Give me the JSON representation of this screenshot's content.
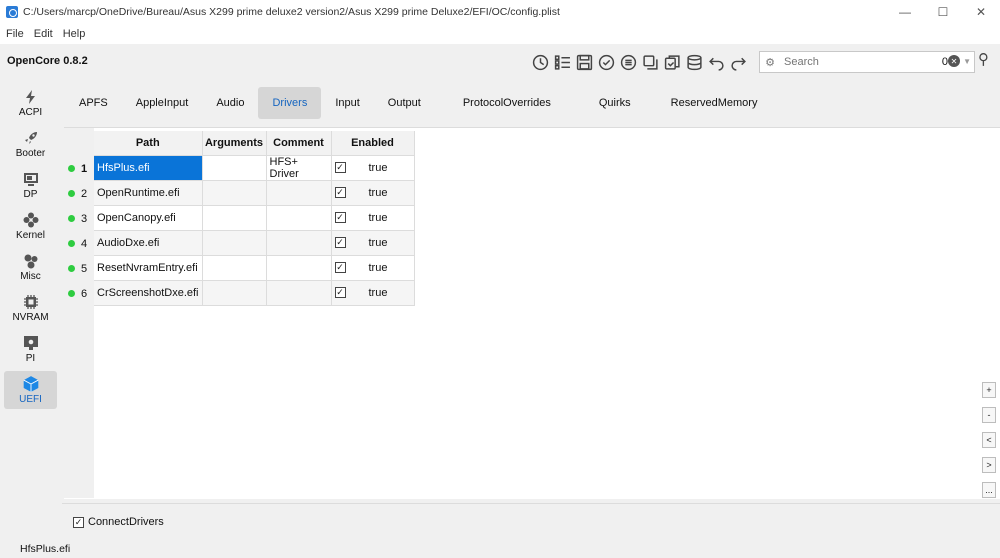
{
  "window": {
    "title": "C:/Users/marcp/OneDrive/Bureau/Asus X299 prime deluxe2 version2/Asus X299 prime Deluxe2/EFI/OC/config.plist",
    "controls": [
      "—",
      "☐",
      "✕"
    ]
  },
  "menu": [
    "File",
    "Edit",
    "Help"
  ],
  "toolbar": {
    "app_version": "OpenCore 0.8.2",
    "icons": [
      "clock-icon",
      "list-icon",
      "save-icon",
      "check-icon",
      "dots-icon",
      "layers-icon",
      "copy-icon",
      "database-icon",
      "undo-icon",
      "redo-icon"
    ],
    "search_placeholder": "Search",
    "search_count": "0"
  },
  "sidebar": [
    {
      "label": "ACPI",
      "icon": "bolt-icon"
    },
    {
      "label": "Booter",
      "icon": "rocket-icon"
    },
    {
      "label": "DP",
      "icon": "device-icon"
    },
    {
      "label": "Kernel",
      "icon": "kernel-icon"
    },
    {
      "label": "Misc",
      "icon": "misc-icon"
    },
    {
      "label": "NVRAM",
      "icon": "chip-icon"
    },
    {
      "label": "PI",
      "icon": "apple-icon"
    },
    {
      "label": "UEFI",
      "icon": "cube-icon",
      "active": true
    }
  ],
  "tabs": [
    {
      "label": "APFS"
    },
    {
      "label": "AppleInput"
    },
    {
      "label": "Audio"
    },
    {
      "label": "Drivers",
      "active": true
    },
    {
      "label": "Input"
    },
    {
      "label": "Output"
    },
    {
      "label": "ProtocolOverrides"
    },
    {
      "label": "Quirks"
    },
    {
      "label": "ReservedMemory"
    }
  ],
  "table": {
    "headers": [
      "Path",
      "Arguments",
      "Comment",
      "Enabled"
    ],
    "rows": [
      {
        "num": "1",
        "path": "HfsPlus.efi",
        "arguments": "",
        "comment": "HFS+ Driver",
        "enabled": "true",
        "selected": true
      },
      {
        "num": "2",
        "path": "OpenRuntime.efi",
        "arguments": "",
        "comment": "",
        "enabled": "true"
      },
      {
        "num": "3",
        "path": "OpenCanopy.efi",
        "arguments": "",
        "comment": "",
        "enabled": "true"
      },
      {
        "num": "4",
        "path": "AudioDxe.efi",
        "arguments": "",
        "comment": "",
        "enabled": "true"
      },
      {
        "num": "5",
        "path": "ResetNvramEntry.efi",
        "arguments": "",
        "comment": "",
        "enabled": "true"
      },
      {
        "num": "6",
        "path": "CrScreenshotDxe.efi",
        "arguments": "",
        "comment": "",
        "enabled": "true"
      }
    ]
  },
  "side_buttons": [
    "+",
    "-",
    "<",
    ">",
    "..."
  ],
  "connect_drivers": {
    "label": "ConnectDrivers",
    "checked": true
  },
  "status": "HfsPlus.efi"
}
